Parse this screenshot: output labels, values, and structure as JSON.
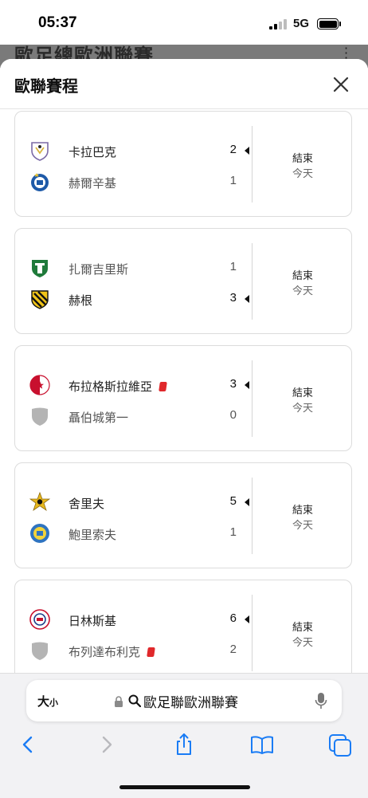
{
  "status_bar": {
    "time": "05:37",
    "network": "5G"
  },
  "background_page": {
    "title": "歐足總歐洲聯賽"
  },
  "sheet": {
    "title": "歐聯賽程"
  },
  "matches": [
    {
      "home": {
        "name": "卡拉巴克",
        "score": "2",
        "winner": true,
        "red_card": false,
        "logo_icon": "qarabag-crest-icon"
      },
      "away": {
        "name": "赫爾辛基",
        "score": "1",
        "winner": false,
        "red_card": false,
        "logo_icon": "hjk-helsinki-crest-icon"
      },
      "status": "結束",
      "date": "今天"
    },
    {
      "home": {
        "name": "扎爾吉里斯",
        "score": "1",
        "winner": false,
        "red_card": false,
        "logo_icon": "zalgiris-crest-icon"
      },
      "away": {
        "name": "赫根",
        "score": "3",
        "winner": true,
        "red_card": false,
        "logo_icon": "hacken-crest-icon"
      },
      "status": "結束",
      "date": "今天"
    },
    {
      "home": {
        "name": "布拉格斯拉維亞",
        "score": "3",
        "winner": true,
        "red_card": true,
        "logo_icon": "slavia-praha-crest-icon"
      },
      "away": {
        "name": "聶伯城第一",
        "score": "0",
        "winner": false,
        "red_card": false,
        "logo_icon": "placeholder-shield-icon"
      },
      "status": "結束",
      "date": "今天"
    },
    {
      "home": {
        "name": "舍里夫",
        "score": "5",
        "winner": true,
        "red_card": false,
        "logo_icon": "sheriff-crest-icon"
      },
      "away": {
        "name": "鮑里索夫",
        "score": "1",
        "winner": false,
        "red_card": false,
        "logo_icon": "bate-borisov-crest-icon"
      },
      "status": "結束",
      "date": "今天"
    },
    {
      "home": {
        "name": "日林斯基",
        "score": "6",
        "winner": true,
        "red_card": false,
        "logo_icon": "zrinjski-crest-icon"
      },
      "away": {
        "name": "布列達布利克",
        "score": "2",
        "winner": false,
        "red_card": true,
        "logo_icon": "placeholder-shield-icon"
      },
      "status": "結束",
      "date": "今天"
    }
  ],
  "browser": {
    "text_size_label": "大",
    "text_size_small": "小",
    "address": "歐足聯歐洲聯賽"
  },
  "colors": {
    "red_card": "#e0282b",
    "divider": "#d6d6d6",
    "ios_blue": "#1a7cf5"
  }
}
